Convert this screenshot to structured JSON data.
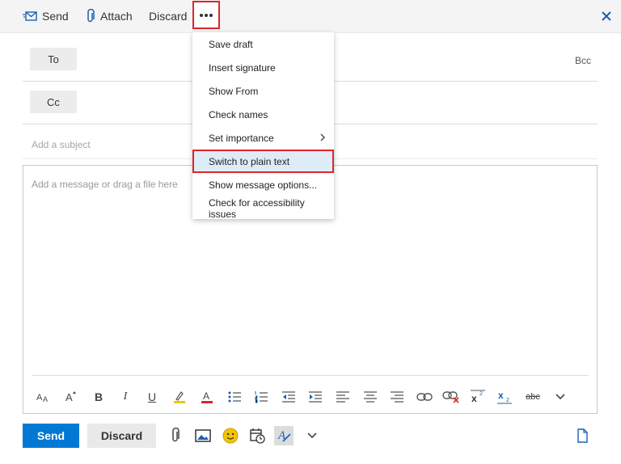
{
  "toolbar": {
    "send_label": "Send",
    "attach_label": "Attach",
    "discard_label": "Discard",
    "more_icon": "ellipsis-icon",
    "close_icon": "close-icon"
  },
  "recipients": {
    "to_label": "To",
    "cc_label": "Cc",
    "bcc_label": "Bcc"
  },
  "subject": {
    "placeholder": "Add a subject"
  },
  "body": {
    "placeholder": "Add a message or drag a file here"
  },
  "menu": {
    "items": [
      {
        "label": "Save draft"
      },
      {
        "label": "Insert signature"
      },
      {
        "label": "Show From"
      },
      {
        "label": "Check names"
      },
      {
        "label": "Set importance"
      },
      {
        "label": "Switch to plain text"
      },
      {
        "label": "Show message options..."
      },
      {
        "label": "Check for accessibility issues"
      }
    ]
  },
  "format_bar": {
    "icons": [
      "font-size-icon",
      "grow-font-icon",
      "bold-icon",
      "italic-icon",
      "underline-icon",
      "highlight-icon",
      "font-color-icon",
      "bullets-icon",
      "numbering-icon",
      "decrease-indent-icon",
      "increase-indent-icon",
      "align-left-icon",
      "align-center-icon",
      "align-right-icon",
      "insert-link-icon",
      "remove-link-icon",
      "superscript-icon",
      "subscript-icon",
      "strikethrough-icon",
      "more-options-icon"
    ],
    "bold_glyph": "B",
    "italic_glyph": "I",
    "underline_glyph": "U",
    "strike_glyph": "abc"
  },
  "bottom": {
    "send_label": "Send",
    "discard_label": "Discard"
  },
  "colors": {
    "accent": "#0078d4",
    "highlight_border": "#e0242b",
    "highlight_bg": "#deecf9"
  }
}
